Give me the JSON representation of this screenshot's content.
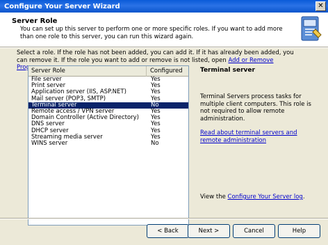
{
  "window": {
    "title": "Configure Your Server Wizard",
    "close_glyph": "✕"
  },
  "header": {
    "title": "Server Role",
    "description": "You can set up this server to perform one or more specific roles. If you want to add more than one role to this server, you can run this wizard again."
  },
  "intro": {
    "text": "Select a role. If the role has not been added, you can add it. If it has already been added, you can remove it. If the role you want to add or remove is not listed, open ",
    "link": "Add or Remove Programs",
    "suffix": "."
  },
  "list": {
    "col_role": "Server Role",
    "col_configured": "Configured",
    "rows": [
      {
        "role": "File server",
        "configured": "Yes"
      },
      {
        "role": "Print server",
        "configured": "Yes"
      },
      {
        "role": "Application server (IIS, ASP.NET)",
        "configured": "Yes"
      },
      {
        "role": "Mail server (POP3, SMTP)",
        "configured": "Yes"
      },
      {
        "role": "Terminal server",
        "configured": "No"
      },
      {
        "role": "Remote access / VPN server",
        "configured": "Yes"
      },
      {
        "role": "Domain Controller (Active Directory)",
        "configured": "Yes"
      },
      {
        "role": "DNS server",
        "configured": "Yes"
      },
      {
        "role": "DHCP server",
        "configured": "Yes"
      },
      {
        "role": "Streaming media server",
        "configured": "Yes"
      },
      {
        "role": "WINS server",
        "configured": "No"
      }
    ],
    "selected_index": 4
  },
  "detail": {
    "title": "Terminal server",
    "description": "Terminal Servers process tasks for multiple client computers. This role is not required to allow remote administration.",
    "link": "Read about terminal servers and remote administration",
    "footer_prefix": "View the ",
    "footer_link": "Configure Your Server log",
    "footer_suffix": "."
  },
  "buttons": {
    "back": "< Back",
    "next": "Next >",
    "cancel": "Cancel",
    "help": "Help"
  }
}
